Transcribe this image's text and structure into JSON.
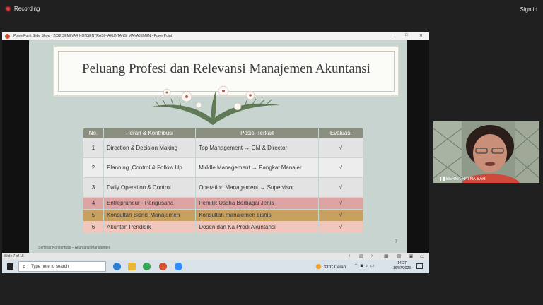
{
  "meeting": {
    "recording_label": "Recording",
    "signin_label": "Sign in"
  },
  "window": {
    "title": "PowerPoint Slide Show  -  2022 SEMINAR KONSENTRASI - AKUNTANSI MANAJEMEN  -  PowerPoint",
    "minimize": "–",
    "maximize": "□",
    "close": "✕"
  },
  "slide": {
    "title": "Peluang Profesi dan Relevansi Manajemen Akuntansi",
    "table": {
      "headers": [
        "No.",
        "Peran & Kontribusi",
        "Posisi Terkait",
        "Evaluasi"
      ],
      "rows": [
        {
          "no": "1",
          "peran": "Direction & Decision Making",
          "posisi": "Top Management → GM & Director",
          "evaluasi": "√",
          "color": "#e3e3e3"
        },
        {
          "no": "2",
          "peran": "Planning ,Control & Follow Up",
          "posisi": "Middle Management → Pangkat Manajer",
          "evaluasi": "√",
          "color": "#ededed"
        },
        {
          "no": "3",
          "peran": "Daily Operation & Control",
          "posisi": "Operation Management → Supervisor",
          "evaluasi": "√",
          "color": "#e3e3e3"
        },
        {
          "no": "4",
          "peran": "Entrepruneur - Pengusaha",
          "posisi": "Pemilik Usaha Berbagai Jenis",
          "evaluasi": "√",
          "color": "#dea3a3"
        },
        {
          "no": "5",
          "peran": "Konsultan Bisnis Manajemen",
          "posisi": "Konsultan  manajemen bisnis",
          "evaluasi": "√",
          "color": "#c8a060"
        },
        {
          "no": "6",
          "peran": "Akuntan Pendidik",
          "posisi": "Dosen dan Ka Prodi Akuntansi",
          "evaluasi": "√",
          "color": "#f1c7bd"
        }
      ]
    },
    "footer": "Seminar Konsentrasi – Akuntansi  Manajemen",
    "page_number": "7"
  },
  "status_bar": {
    "slide_indicator": "Slide 7 of 15",
    "prev": "‹",
    "next": "›"
  },
  "taskbar": {
    "search_placeholder": "Type here to search",
    "weather_temp": "33°C",
    "weather_desc": "Cerah",
    "time": "14:27",
    "date": "16/07/2023"
  },
  "participant": {
    "name": "BERNA RATNA SARI"
  }
}
